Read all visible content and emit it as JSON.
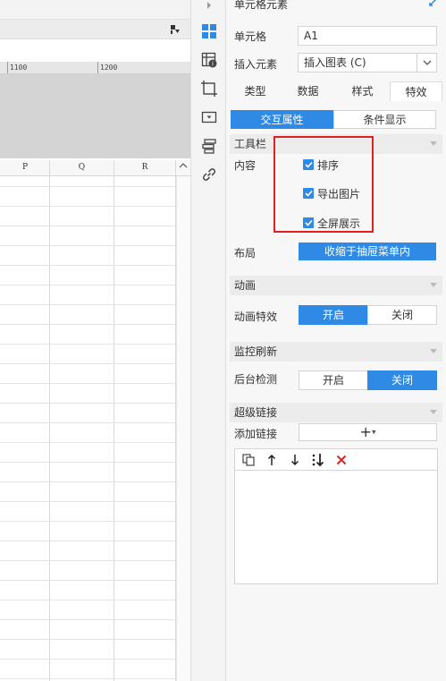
{
  "sheet": {
    "ruler_labels": [
      "1100",
      "1200"
    ],
    "columns": [
      "P",
      "Q",
      "R"
    ]
  },
  "icon_strip": {
    "icons": [
      "cell-element-icon",
      "cell-attribute-icon",
      "border-icon",
      "widget-icon",
      "condition-icon",
      "hyperlink-icon"
    ]
  },
  "panel": {
    "title": "单元格元素",
    "cell_label": "单元格",
    "cell_value": "A1",
    "insert_label": "插入元素",
    "insert_value": "插入图表 (C)",
    "tabs": [
      "类型",
      "数据",
      "样式",
      "特效"
    ],
    "active_tab": "特效",
    "subtabs": [
      "交互属性",
      "条件显示"
    ],
    "active_subtab": "交互属性",
    "toolbar_section": "工具栏",
    "content_label": "内容",
    "checkboxes": [
      "排序",
      "导出图片",
      "全屏展示"
    ],
    "layout_label": "布局",
    "layout_value": "收缩于抽屉菜单内",
    "animation_section": "动画",
    "animation_label": "动画特效",
    "animation_on": "开启",
    "animation_off": "关闭",
    "animation_selected": "开启",
    "monitor_section": "监控刷新",
    "monitor_label": "后台检测",
    "monitor_on": "开启",
    "monitor_off": "关闭",
    "monitor_selected": "关闭",
    "hyperlink_section": "超级链接",
    "add_link_label": "添加链接",
    "add_link_button": "+",
    "accent_color": "#2f8ae5",
    "highlight_color": "#e02020"
  }
}
